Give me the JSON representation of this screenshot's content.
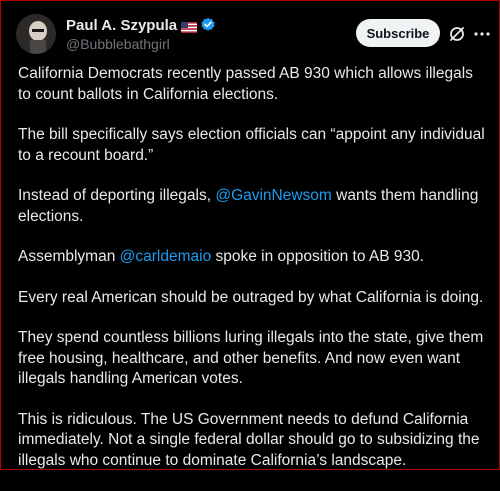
{
  "author": {
    "display_name": "Paul A. Szypula",
    "handle": "@Bubblebathgirl",
    "flag": "us-flag-icon",
    "verified": "verified-badge-icon"
  },
  "actions": {
    "subscribe_label": "Subscribe",
    "grok_icon": "grok-icon",
    "more_icon": "more-options-icon"
  },
  "colors": {
    "background": "#000000",
    "text": "#e7e9ea",
    "secondary": "#71767b",
    "link": "#1d9bf0",
    "button_bg": "#eff3f4"
  },
  "post": {
    "p1": "California Democrats recently passed AB 930 which allows illegals to count ballots in California elections.",
    "p2": "The bill specifically says election officials can “appoint any individual to a recount board.”",
    "p3_before": "Instead of deporting illegals, ",
    "p3_mention": "@GavinNewsom",
    "p3_after": " wants them handling elections.",
    "p4_before": "Assemblyman ",
    "p4_mention": "@carldemaio",
    "p4_after": " spoke in opposition to AB 930.",
    "p5": "Every real American should be outraged by what California is doing.",
    "p6": "They spend countless billions luring illegals into the state, give them free housing, healthcare, and other benefits. And now even want illegals handling American votes.",
    "p7": "This is ridiculous. The US Government needs to defund California immediately. Not a single federal dollar should go to subsidizing the illegals who continue to dominate California’s landscape."
  }
}
